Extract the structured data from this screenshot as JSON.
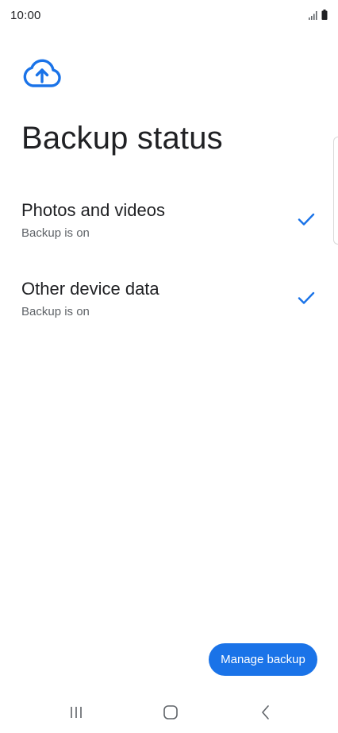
{
  "status_bar": {
    "time": "10:00"
  },
  "header": {
    "icon": "cloud-upload-icon",
    "title": "Backup status"
  },
  "items": [
    {
      "title": "Photos and videos",
      "subtitle": "Backup is on",
      "status_icon": "check-icon"
    },
    {
      "title": "Other device data",
      "subtitle": "Backup is on",
      "status_icon": "check-icon"
    }
  ],
  "actions": {
    "manage_label": "Manage backup"
  },
  "nav_bar": {
    "buttons": [
      "recent-apps-icon",
      "home-icon",
      "back-icon"
    ]
  },
  "colors": {
    "accent": "#1a73e8",
    "text_primary": "#202124",
    "text_secondary": "#5f6368",
    "background": "#ffffff"
  }
}
